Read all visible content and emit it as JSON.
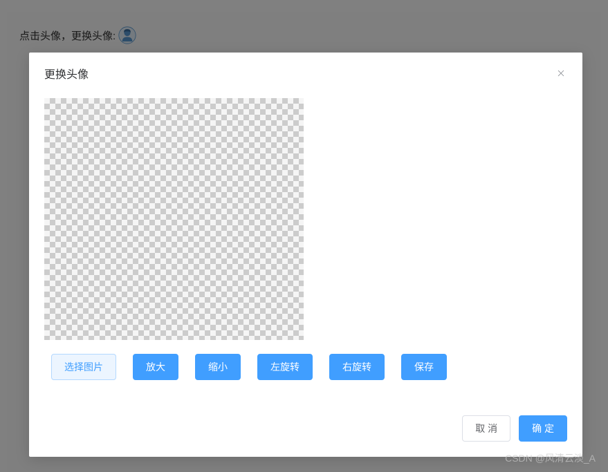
{
  "page": {
    "header_text": "点击头像，更换头像:"
  },
  "dialog": {
    "title": "更换头像",
    "toolbar": {
      "select_image": "选择图片",
      "zoom_in": "放大",
      "zoom_out": "缩小",
      "rotate_left": "左旋转",
      "rotate_right": "右旋转",
      "save": "保存"
    },
    "footer": {
      "cancel": "取 消",
      "confirm": "确 定"
    }
  },
  "watermark": "CSDN @风清云淡_A"
}
